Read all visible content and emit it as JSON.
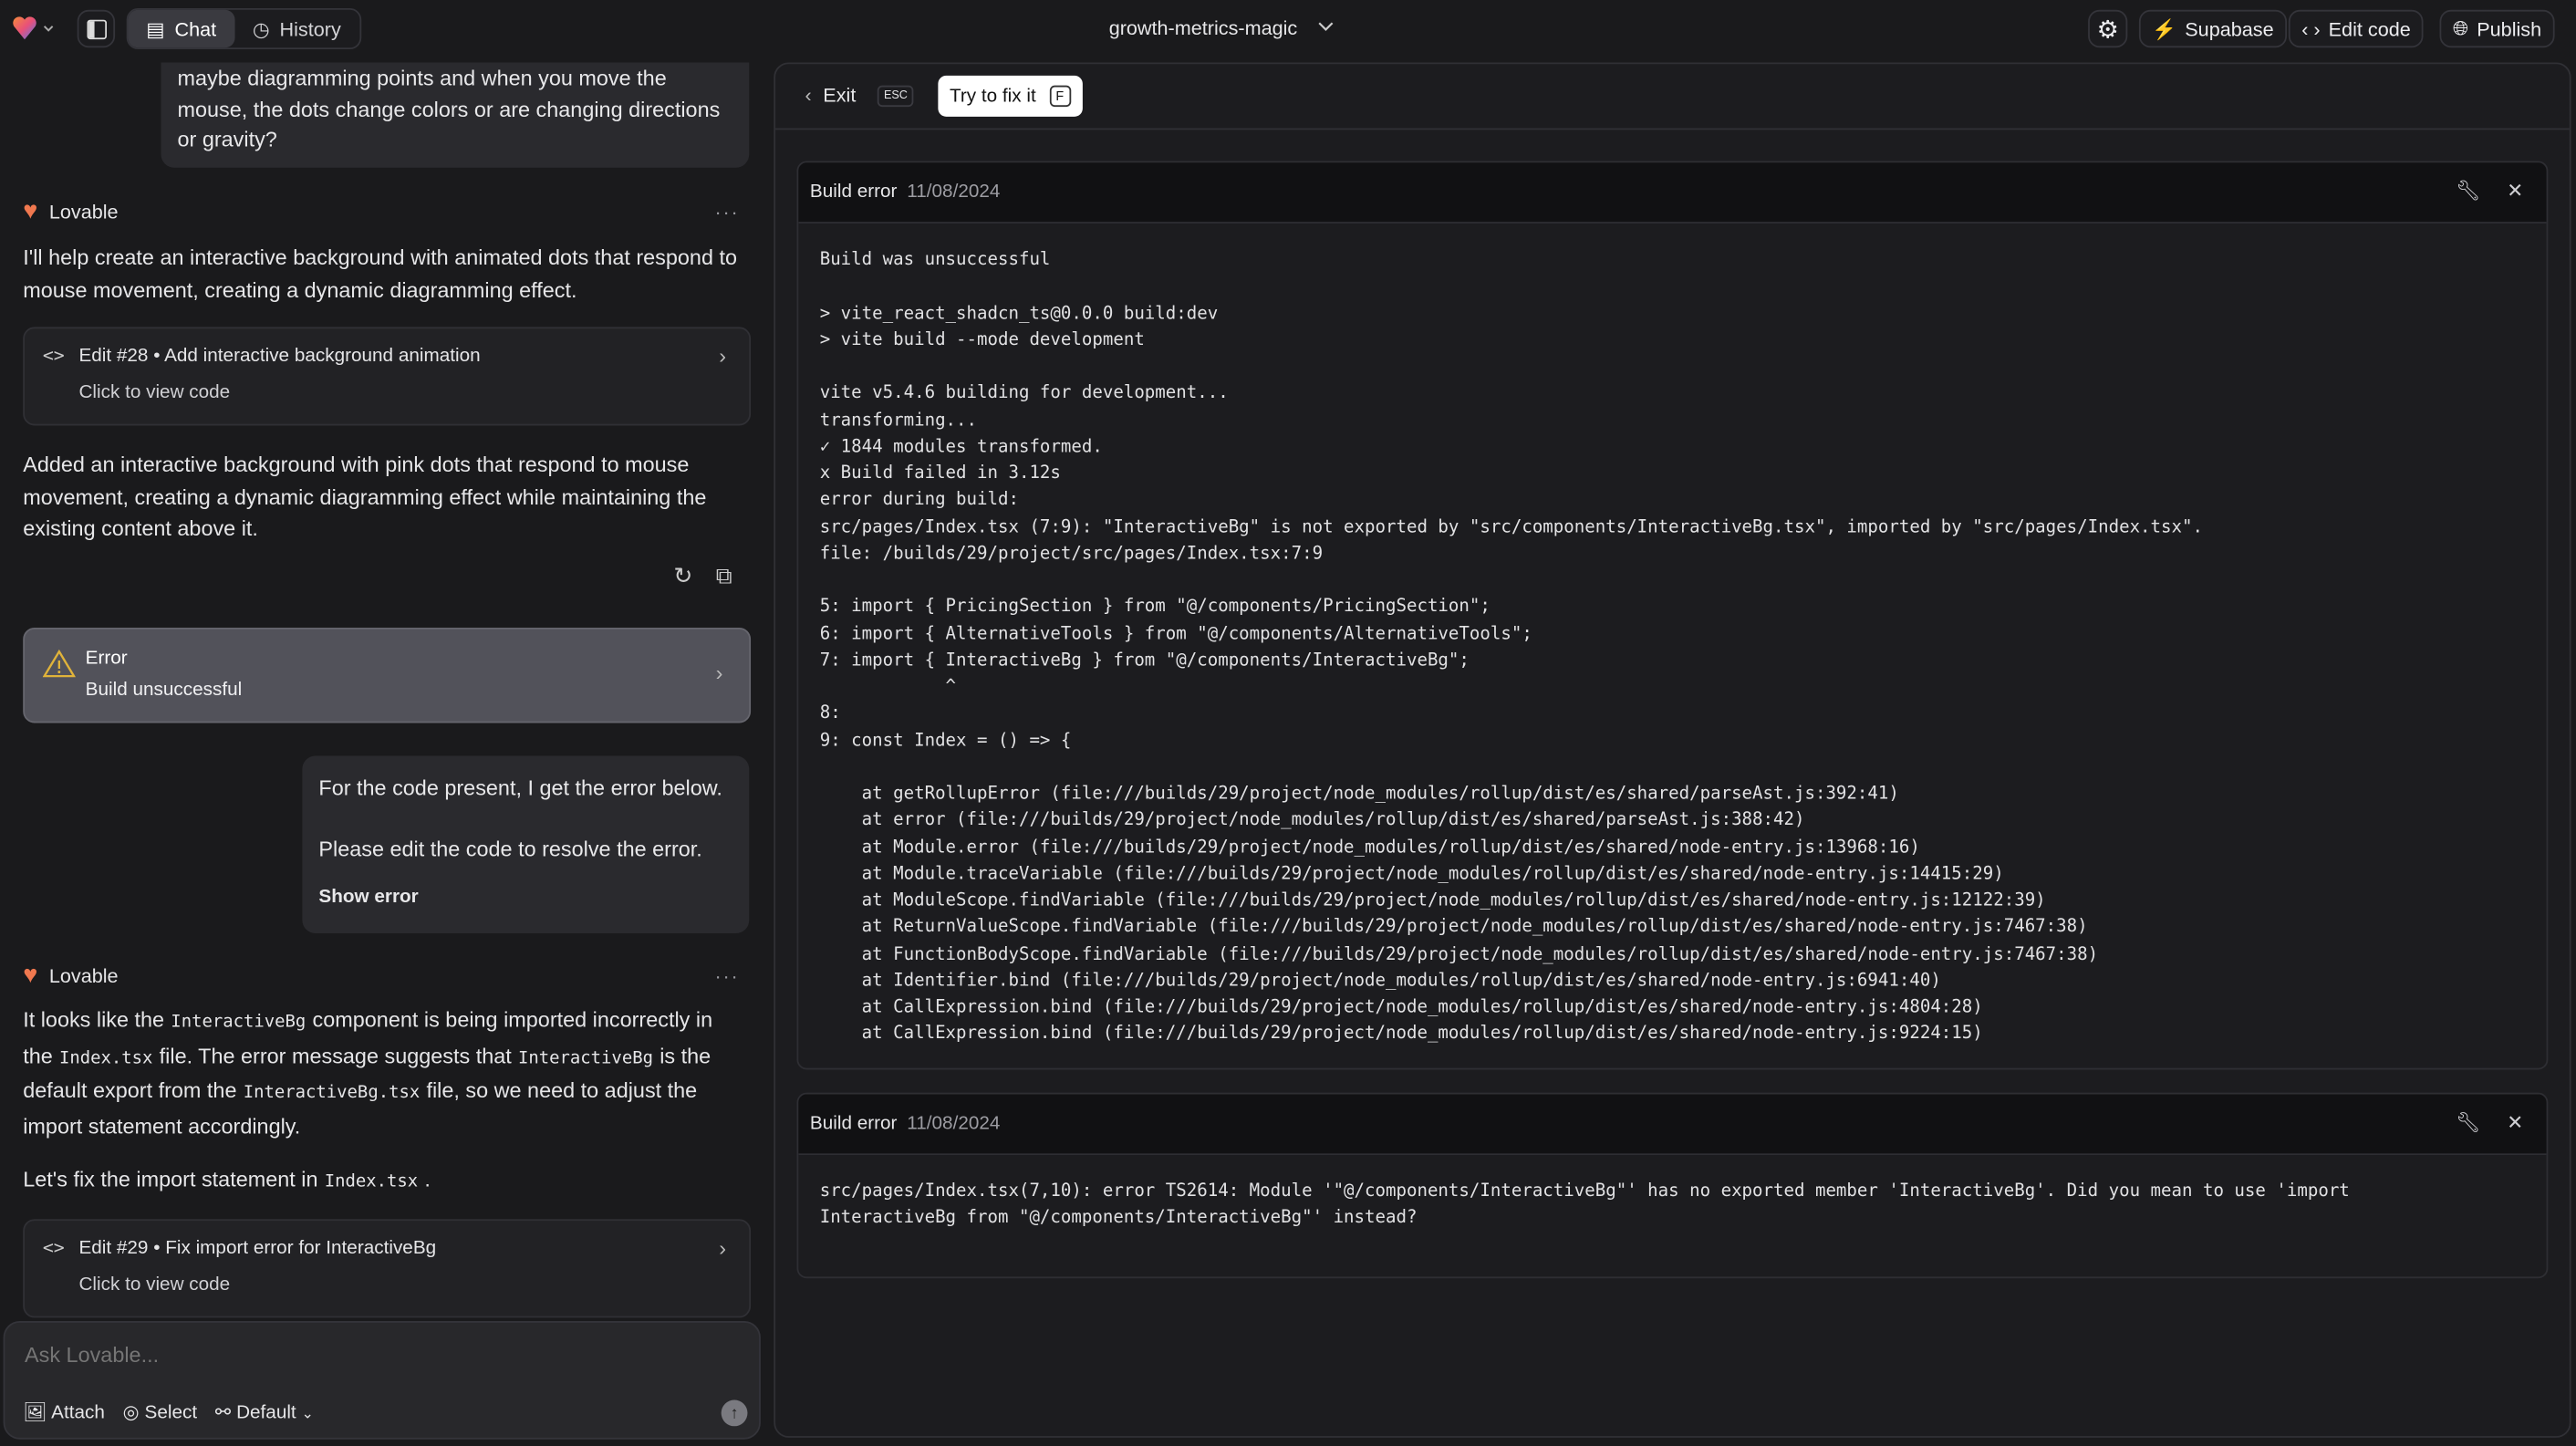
{
  "topbar": {
    "tabs": [
      {
        "label": "Chat",
        "active": true
      },
      {
        "label": "History",
        "active": false
      }
    ],
    "project_name": "growth-metrics-magic",
    "buttons": {
      "supabase": "Supabase",
      "edit_code": "Edit code",
      "publish": "Publish"
    }
  },
  "chat": {
    "user_msg_1": "maybe diagramming points and when you move the mouse, the dots change colors or are changing directions or gravity?",
    "assistant_name": "Lovable",
    "assistant_1_intro": "I'll help create an interactive background with animated dots that respond to mouse movement, creating a dynamic diagramming effect.",
    "edit_28": {
      "title": "Edit #28 • Add interactive background animation",
      "subtitle": "Click to view code"
    },
    "assistant_1_outro": "Added an interactive background with pink dots that respond to mouse movement, creating a dynamic diagramming effect while maintaining the existing content above it.",
    "error_card": {
      "title": "Error",
      "subtitle": "Build unsuccessful"
    },
    "user_msg_2": {
      "line1": "For the code present, I get the error below.",
      "line2": "Please edit the code to resolve the error.",
      "show_error": "Show error"
    },
    "assistant_2": {
      "p1": [
        "It looks like the",
        "InteractiveBg",
        "component is being imported incorrectly in the",
        "Index.tsx",
        "file. The error message suggests that",
        "InteractiveBg",
        "is the default export from the",
        "InteractiveBg.tsx",
        "file, so we need to adjust the import statement accordingly."
      ],
      "p2": [
        "Let's fix the import statement in",
        "Index.tsx",
        "."
      ]
    },
    "edit_29": {
      "title": "Edit #29 • Fix import error for InteractiveBg",
      "subtitle": "Click to view code"
    },
    "input": {
      "placeholder": "Ask Lovable...",
      "attach": "Attach",
      "select": "Select",
      "mode": "Default"
    }
  },
  "panel": {
    "exit": "Exit",
    "exit_key": "ESC",
    "fix": "Try to fix it",
    "fix_key": "F",
    "errors": [
      {
        "title": "Build error",
        "date": "11/08/2024",
        "log": "Build was unsuccessful\n\n> vite_react_shadcn_ts@0.0.0 build:dev\n> vite build --mode development\n\nvite v5.4.6 building for development...\ntransforming...\n✓ 1844 modules transformed.\nx Build failed in 3.12s\nerror during build:\nsrc/pages/Index.tsx (7:9): \"InteractiveBg\" is not exported by \"src/components/InteractiveBg.tsx\", imported by \"src/pages/Index.tsx\".\nfile: /builds/29/project/src/pages/Index.tsx:7:9\n\n5: import { PricingSection } from \"@/components/PricingSection\";\n6: import { AlternativeTools } from \"@/components/AlternativeTools\";\n7: import { InteractiveBg } from \"@/components/InteractiveBg\";\n            ^\n8:\n9: const Index = () => {\n\n    at getRollupError (file:///builds/29/project/node_modules/rollup/dist/es/shared/parseAst.js:392:41)\n    at error (file:///builds/29/project/node_modules/rollup/dist/es/shared/parseAst.js:388:42)\n    at Module.error (file:///builds/29/project/node_modules/rollup/dist/es/shared/node-entry.js:13968:16)\n    at Module.traceVariable (file:///builds/29/project/node_modules/rollup/dist/es/shared/node-entry.js:14415:29)\n    at ModuleScope.findVariable (file:///builds/29/project/node_modules/rollup/dist/es/shared/node-entry.js:12122:39)\n    at ReturnValueScope.findVariable (file:///builds/29/project/node_modules/rollup/dist/es/shared/node-entry.js:7467:38)\n    at FunctionBodyScope.findVariable (file:///builds/29/project/node_modules/rollup/dist/es/shared/node-entry.js:7467:38)\n    at Identifier.bind (file:///builds/29/project/node_modules/rollup/dist/es/shared/node-entry.js:6941:40)\n    at CallExpression.bind (file:///builds/29/project/node_modules/rollup/dist/es/shared/node-entry.js:4804:28)\n    at CallExpression.bind (file:///builds/29/project/node_modules/rollup/dist/es/shared/node-entry.js:9224:15)"
      },
      {
        "title": "Build error",
        "date": "11/08/2024",
        "log": "src/pages/Index.tsx(7,10): error TS2614: Module '\"@/components/InteractiveBg\"' has no exported member 'InteractiveBg'. Did you mean to use 'import\nInteractiveBg from \"@/components/InteractiveBg\"' instead?"
      }
    ]
  },
  "colors": {
    "background": "#1a1a1c",
    "supabase_green": "#3ecf8e",
    "warning": "#e0b33a",
    "fix_button": "#ffffff"
  }
}
